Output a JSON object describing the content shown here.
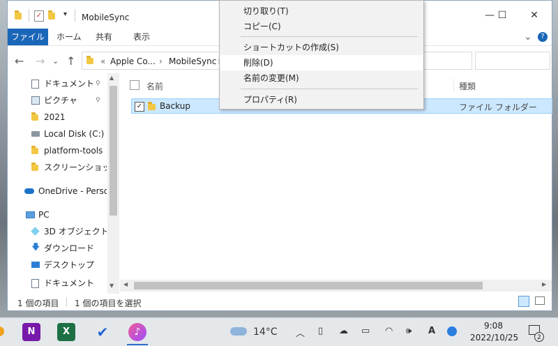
{
  "window": {
    "title": "MobileSync",
    "controls": {
      "minimize": "—",
      "maximize": "☐",
      "close": "✕"
    }
  },
  "ribbon": {
    "tabs": [
      "ファイル",
      "ホーム",
      "共有",
      "表示"
    ],
    "expand_glyph": "⌄",
    "help_glyph": "?"
  },
  "address": {
    "back": "←",
    "forward": "→",
    "recent": "⌄",
    "up": "↑",
    "overflow": "«",
    "crumbs": [
      "Apple Co...",
      "MobileSync"
    ],
    "sep": "›"
  },
  "nav": {
    "items": [
      {
        "label": "ドキュメント",
        "icon": "document-icon",
        "pinned": true
      },
      {
        "label": "ピクチャ",
        "icon": "picture-icon",
        "pinned": true
      },
      {
        "label": "2021",
        "icon": "folder-icon",
        "pinned": false
      },
      {
        "label": "Local Disk (C:)",
        "icon": "drive-icon",
        "pinned": false
      },
      {
        "label": "platform-tools",
        "icon": "folder-icon",
        "pinned": false
      },
      {
        "label": "スクリーンショット",
        "icon": "folder-icon",
        "pinned": false
      },
      {
        "label": "OneDrive - Person",
        "icon": "cloud-icon",
        "pinned": false
      },
      {
        "label": "PC",
        "icon": "pc-icon",
        "pinned": false
      },
      {
        "label": "3D オブジェクト",
        "icon": "cube-icon",
        "pinned": false
      },
      {
        "label": "ダウンロード",
        "icon": "download-icon",
        "pinned": false
      },
      {
        "label": "デスクトップ",
        "icon": "desktop-icon",
        "pinned": false
      },
      {
        "label": "ドキュメント",
        "icon": "document-icon",
        "pinned": false
      }
    ],
    "pin_glyph": "📌"
  },
  "files": {
    "columns": {
      "name": "名前",
      "type": "種類"
    },
    "rows": [
      {
        "name": "Backup",
        "type": "ファイル フォルダー",
        "checked": true
      }
    ]
  },
  "status": {
    "count": "1 個の項目",
    "selected": "1 個の項目を選択"
  },
  "context_menu": {
    "items": [
      "切り取り(T)",
      "コピー(C)",
      "ショートカットの作成(S)",
      "削除(D)",
      "名前の変更(M)",
      "プロパティ(R)"
    ],
    "highlighted_index": 3
  },
  "taskbar": {
    "weather_temp": "14°C",
    "ime": "A",
    "time": "9:08",
    "date": "2022/10/25",
    "notification_count": "2",
    "apps": [
      "OneNote",
      "Excel",
      "To Do",
      "iTunes"
    ],
    "app_letters": {
      "onenote": "N",
      "excel": "X",
      "todo": "✔",
      "itunes": "♪"
    }
  },
  "colors": {
    "accent": "#1a66b8",
    "selection": "#cce8ff",
    "folder": "#f2c744"
  }
}
